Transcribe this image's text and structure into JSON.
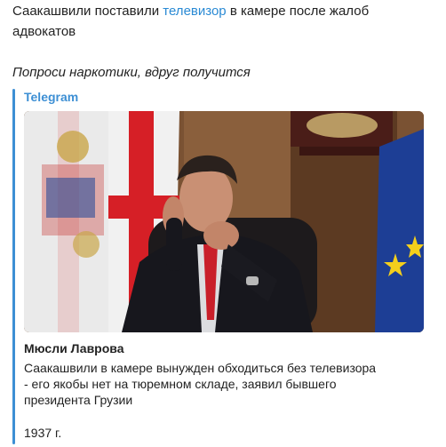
{
  "message": {
    "line1_before": "Саакашвили поставили ",
    "line1_link": "телевизор",
    "line1_after": " в камере после жалоб",
    "line2": "адвокатов",
    "comment": "Попроси наркотики, вдруг получится"
  },
  "preview": {
    "site_name": "Telegram",
    "title": "Мюсли Лаврова",
    "description_lines": [
      "Саакашвили в камере вынужден обходиться без телевизора",
      "- его якобы нет на тюремном складе, заявил бывшего",
      "президента Грузии"
    ],
    "footer": "1937 г."
  },
  "colors": {
    "link": "#2a8ad4",
    "accent_bar": "#3d8fd4",
    "text": "#222222"
  }
}
